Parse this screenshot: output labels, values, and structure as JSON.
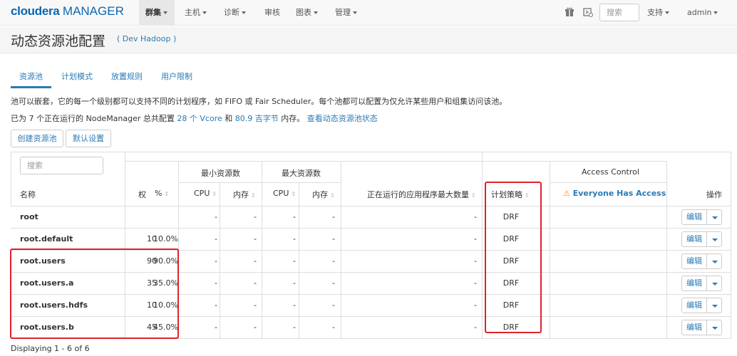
{
  "nav": {
    "logo_brand": "cloudera",
    "logo_product": "MANAGER",
    "items": [
      {
        "label": "群集",
        "active": true
      },
      {
        "label": "主机"
      },
      {
        "label": "诊断"
      },
      {
        "label": "审核"
      },
      {
        "label": "图表"
      },
      {
        "label": "管理"
      }
    ],
    "search_placeholder": "搜索",
    "support": "支持",
    "user": "admin"
  },
  "header": {
    "title": "动态资源池配置",
    "cluster": "( Dev Hadoop )"
  },
  "tabs": [
    "资源池",
    "计划模式",
    "放置规则",
    "用户限制"
  ],
  "description": {
    "line1": "池可以嵌套，它的每一个级别都可以支持不同的计划程序，如 FIFO 或 Fair Scheduler。每个池都可以配置为仅允许某些用户和组集访问该池。",
    "line2_pre": "已为 7 个正在运行的 NodeManager 总共配置 ",
    "vcore_link": "28 个 Vcore",
    "line2_mid": " 和 ",
    "mem_link": "80.9 吉字节",
    "line2_post": " 内存。",
    "status_link": "查看动态资源池状态"
  },
  "buttons": {
    "create_pool": "创建资源池",
    "defaults": "默认设置"
  },
  "table": {
    "search_placeholder": "搜索",
    "headers": {
      "name": "名称",
      "weight": "权",
      "percent": "%",
      "min_resources": "最小资源数",
      "max_resources": "最大资源数",
      "cpu": "CPU",
      "memory": "内存",
      "max_running_apps": "正在运行的应用程序最大数量",
      "scheduling_policy": "计划策略",
      "access_control": "Access Control",
      "everyone_access": "Everyone Has Access",
      "actions": "操作"
    },
    "edit_label": "编辑",
    "rows": [
      {
        "name": "root",
        "weight": "",
        "percent": "",
        "min_cpu": "-",
        "min_mem": "-",
        "max_cpu": "-",
        "max_mem": "-",
        "max_apps": "-",
        "policy": "DRF"
      },
      {
        "name": "root.default",
        "weight": "10",
        "percent": "10.0%",
        "min_cpu": "-",
        "min_mem": "-",
        "max_cpu": "-",
        "max_mem": "-",
        "max_apps": "-",
        "policy": "DRF"
      },
      {
        "name": "root.users",
        "weight": "90",
        "percent": "90.0%",
        "min_cpu": "-",
        "min_mem": "-",
        "max_cpu": "-",
        "max_mem": "-",
        "max_apps": "-",
        "policy": "DRF"
      },
      {
        "name": "root.users.a",
        "weight": "35",
        "percent": "35.0%",
        "min_cpu": "-",
        "min_mem": "-",
        "max_cpu": "-",
        "max_mem": "-",
        "max_apps": "-",
        "policy": "DRF"
      },
      {
        "name": "root.users.hdfs",
        "weight": "10",
        "percent": "10.0%",
        "min_cpu": "-",
        "min_mem": "-",
        "max_cpu": "-",
        "max_mem": "-",
        "max_apps": "-",
        "policy": "DRF"
      },
      {
        "name": "root.users.b",
        "weight": "45",
        "percent": "45.0%",
        "min_cpu": "-",
        "min_mem": "-",
        "max_cpu": "-",
        "max_mem": "-",
        "max_apps": "-",
        "policy": "DRF"
      }
    ]
  },
  "footer": "Displaying 1 - 6 of 6",
  "colors": {
    "link": "#2a7ab5",
    "highlight": "#e0232b",
    "warning": "#e8a200"
  }
}
